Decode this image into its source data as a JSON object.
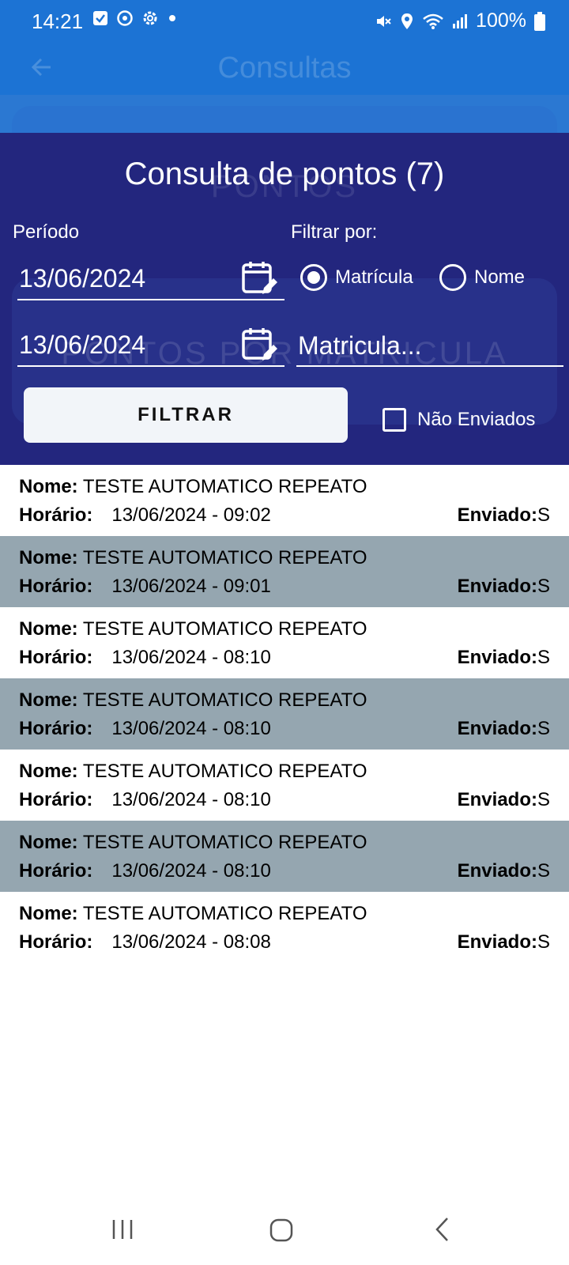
{
  "status_bar": {
    "time": "14:21",
    "battery": "100%"
  },
  "app_bar": {
    "title": "Consultas"
  },
  "background_cards": {
    "card1_label": "PONTOS",
    "card2_label": "PONTOS POR MATRICULA"
  },
  "dialog": {
    "title": "Consulta de pontos (7)",
    "periodo_label": "Período",
    "date_start": "13/06/2024",
    "date_end": "13/06/2024",
    "filtrar_por_label": "Filtrar por:",
    "radio_matricula": "Matrícula",
    "radio_nome": "Nome",
    "selected_filter": "Matrícula",
    "search_placeholder": "Matricula...",
    "search_value": "",
    "filter_button": "FILTRAR",
    "nao_enviados_label": "Não Enviados",
    "nao_enviados_checked": false
  },
  "list": {
    "name_label": "Nome:",
    "time_label": "Horário:",
    "sent_label": "Enviado:",
    "items": [
      {
        "nome": "TESTE AUTOMATICO REPEATO",
        "horario": "13/06/2024 - 09:02",
        "enviado": "S"
      },
      {
        "nome": "TESTE AUTOMATICO REPEATO",
        "horario": "13/06/2024 - 09:01",
        "enviado": "S"
      },
      {
        "nome": "TESTE AUTOMATICO REPEATO",
        "horario": "13/06/2024 - 08:10",
        "enviado": "S"
      },
      {
        "nome": "TESTE AUTOMATICO REPEATO",
        "horario": "13/06/2024 - 08:10",
        "enviado": "S"
      },
      {
        "nome": "TESTE AUTOMATICO REPEATO",
        "horario": "13/06/2024 - 08:10",
        "enviado": "S"
      },
      {
        "nome": "TESTE AUTOMATICO REPEATO",
        "horario": "13/06/2024 - 08:10",
        "enviado": "S"
      },
      {
        "nome": "TESTE AUTOMATICO REPEATO",
        "horario": "13/06/2024 - 08:08",
        "enviado": "S"
      }
    ]
  },
  "colors": {
    "app_bar": "#1c73d4",
    "overlay": "#23267e",
    "alt_row": "#95a6b0",
    "button_bg": "#f2f5f9"
  }
}
